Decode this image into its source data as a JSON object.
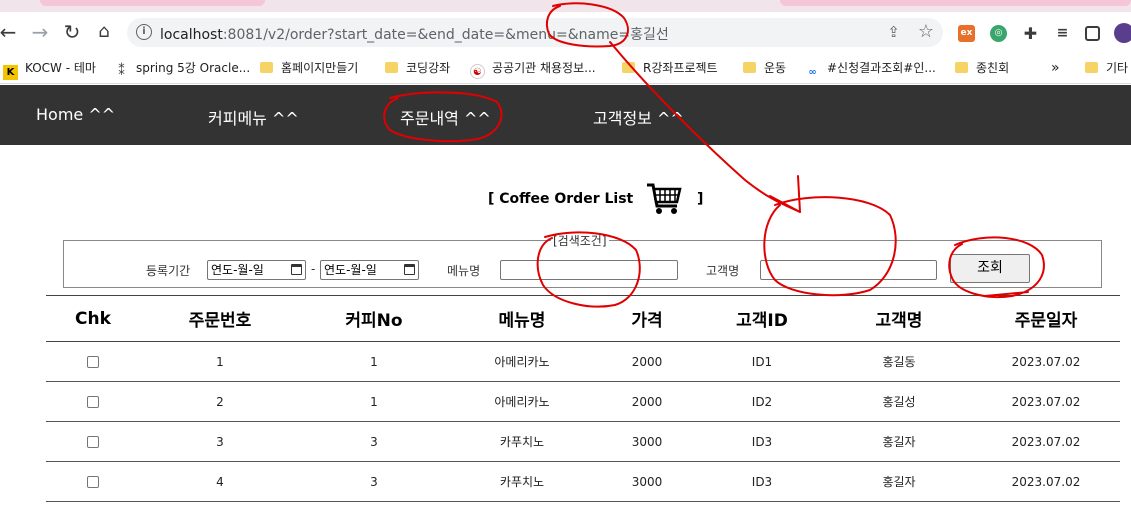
{
  "browser": {
    "url_host": "localhost",
    "url_rest": ":8081/v2/order?start_date=&end_date=&menu=&name=홍길선",
    "bookmarks": [
      {
        "label": "KOCW - 테마",
        "icon": "kocw-icon"
      },
      {
        "label": "spring 5강 Oracle...",
        "icon": "dots-icon"
      },
      {
        "label": "홈페이지만들기",
        "icon": "folder-icon"
      },
      {
        "label": "코딩강좌",
        "icon": "folder-icon"
      },
      {
        "label": "공공기관 채용정보...",
        "icon": "flag-icon"
      },
      {
        "label": "R강좌프로젝트",
        "icon": "folder-icon"
      },
      {
        "label": "운동",
        "icon": "folder-icon"
      },
      {
        "label": "#신청결과조회#인...",
        "icon": "cc-icon"
      },
      {
        "label": "종친회",
        "icon": "folder-icon"
      },
      {
        "label": "»",
        "icon": ""
      },
      {
        "label": "기타",
        "icon": "folder-icon"
      }
    ]
  },
  "nav": {
    "items": [
      "Home ^^",
      "커피메뉴 ^^",
      "주문내역 ^^",
      "고객정보 ^^"
    ]
  },
  "page": {
    "title_open": "[ Coffee Order List",
    "title_close": "]"
  },
  "search": {
    "legend": "[검색조건]",
    "period_label": "등록기간",
    "date_placeholder": "연도-월-일",
    "date_sep": "-",
    "menu_label": "메뉴명",
    "menu_value": "",
    "customer_label": "고객명",
    "customer_value": "",
    "button_label": "조회"
  },
  "table": {
    "headers": [
      "Chk",
      "주문번호",
      "커피No",
      "메뉴명",
      "가격",
      "고객ID",
      "고객명",
      "주문일자"
    ],
    "rows": [
      [
        "1",
        "1",
        "아메리카노",
        "2000",
        "ID1",
        "홍길동",
        "2023.07.02"
      ],
      [
        "2",
        "1",
        "아메리카노",
        "2000",
        "ID2",
        "홍길성",
        "2023.07.02"
      ],
      [
        "3",
        "3",
        "카푸치노",
        "3000",
        "ID3",
        "홍길자",
        "2023.07.02"
      ],
      [
        "4",
        "3",
        "카푸치노",
        "3000",
        "ID3",
        "홍길자",
        "2023.07.02"
      ]
    ]
  },
  "colors": {
    "nav_bg": "#333333",
    "annotation": "#e00000"
  }
}
